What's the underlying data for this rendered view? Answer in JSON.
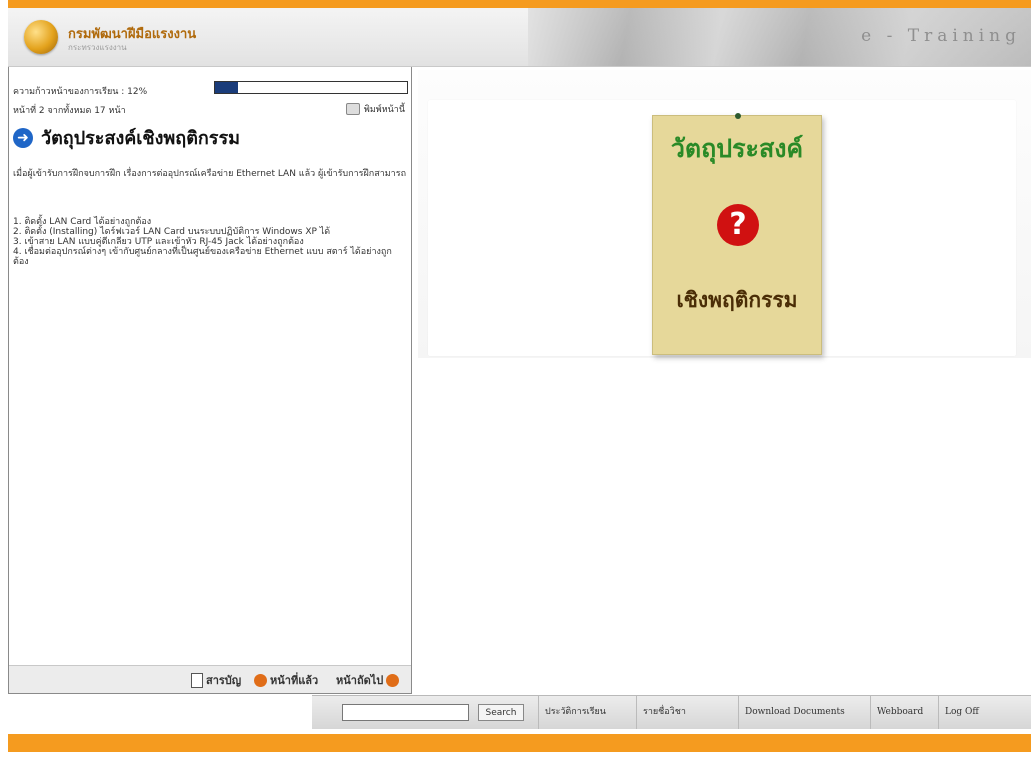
{
  "header": {
    "org_name": "กรมพัฒนาฝีมือแรงงาน",
    "org_subtitle": "กระทรวงแรงงาน",
    "brand": "e - Training"
  },
  "left_panel": {
    "progress_label": "ความก้าวหน้าของการเรียน : 12%",
    "progress_value": 0.12,
    "page_label": "หน้าที่ 2 จากทั้งหมด 17 หน้า",
    "print_label": "พิมพ์หน้านี้",
    "section_title": "วัตถุประสงค์เชิงพฤติกรรม",
    "objective_text": "เมื่อผู้เข้ารับการฝึกจบการฝึก เรื่องการต่ออุปกรณ์เครือข่าย Ethernet LAN แล้ว ผู้เข้ารับการฝึกสามารถ",
    "objectives": [
      "1. ติดตั้ง LAN Card ได้อย่างถูกต้อง",
      "2. ติดตั้ง (Installing) ไดร์ฟเวอร์ LAN Card บนระบบปฏิบัติการ Windows XP ได้",
      "3. เข้าสาย LAN แบบคู่ตีเกลียว UTP และเข้าหัว RJ-45 Jack ได้อย่างถูกต้อง",
      "4. เชื่อมต่ออุปกรณ์ต่างๆ เข้ากับศูนย์กลางที่เป็นศูนย์ของเครือข่าย Ethernet แบบ สตาร์ ได้อย่างถูกต้อง"
    ],
    "nav": {
      "contents": "สารบัญ",
      "prev": "หน้าที่แล้ว",
      "next": "หน้าถัดไป"
    }
  },
  "poster": {
    "top_text": "วัตถุประสงค์",
    "symbol": "?",
    "bottom_text": "เชิงพฤติกรรม"
  },
  "search": {
    "placeholder": "",
    "button": "Search"
  },
  "links": {
    "history": "ประวัติการเรียน",
    "subjects": "รายชื่อวิชา",
    "download": "Download Documents",
    "webboard": "Webboard",
    "logoff": "Log Off"
  },
  "colors": {
    "accent": "#f59b1f",
    "progress": "#1a3c7a",
    "poster_bg": "#e6d89a",
    "question": "#d01111"
  }
}
